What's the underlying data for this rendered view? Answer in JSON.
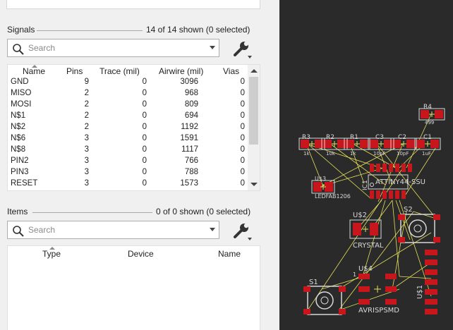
{
  "signals": {
    "title": "Signals",
    "count": "14 of 14 shown (0 selected)",
    "search_placeholder": "Search",
    "columns": [
      "Name",
      "Pins",
      "Trace (mil)",
      "Airwire (mil)",
      "Vias"
    ],
    "rows": [
      [
        "GND",
        "9",
        "0",
        "3096",
        "0"
      ],
      [
        "MISO",
        "2",
        "0",
        "968",
        "0"
      ],
      [
        "MOSI",
        "2",
        "0",
        "809",
        "0"
      ],
      [
        "N$1",
        "2",
        "0",
        "694",
        "0"
      ],
      [
        "N$2",
        "2",
        "0",
        "1192",
        "0"
      ],
      [
        "N$6",
        "3",
        "0",
        "1591",
        "0"
      ],
      [
        "N$8",
        "3",
        "0",
        "1117",
        "0"
      ],
      [
        "PIN2",
        "3",
        "0",
        "766",
        "0"
      ],
      [
        "PIN3",
        "3",
        "0",
        "788",
        "0"
      ],
      [
        "RESET",
        "3",
        "0",
        "1573",
        "0"
      ]
    ]
  },
  "items": {
    "title": "Items",
    "count": "0 of 0 shown (0 selected)",
    "search_placeholder": "Search",
    "columns": [
      "Type",
      "Device",
      "Name"
    ]
  },
  "board": {
    "labels": {
      "r3": "R3",
      "r2": "R2",
      "r1": "R1",
      "c3": "C3",
      "c2": "C2",
      "c1": "C1",
      "r4": "R4",
      "v_1k_a": "1k",
      "v_10k": "10k",
      "v_1k_b": "1k",
      "v_10pf_a": "10pF",
      "v_10pf_b": "10pF",
      "v_1uf": "1uF",
      "v_499": "499",
      "u3": "U$3",
      "ledfab": "LEDFAB1206",
      "ic1": "IC1",
      "attiny": "ATTINY44-SSU",
      "u2": "U$2",
      "s2": "S2",
      "crystal": "CRYSTAL",
      "u4": "U$4",
      "pin1": "1",
      "u1": "U$1",
      "s1": "S1",
      "avrisp": "AVRISPSMD"
    },
    "colors": {
      "background": "#2a2a2a",
      "pad": "#c8161d",
      "silkscreen": "#d8d8d8",
      "airwire": "#e6e05a"
    }
  }
}
